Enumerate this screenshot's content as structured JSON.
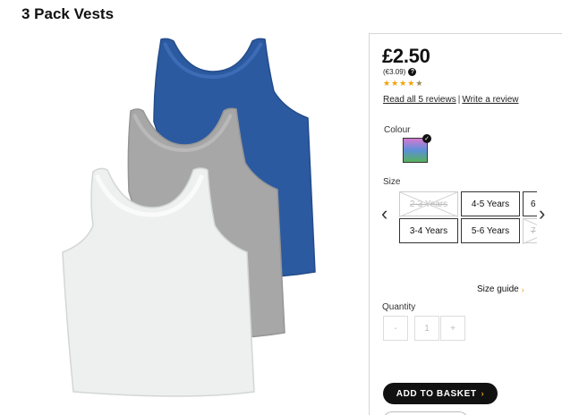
{
  "product": {
    "title": "3 Pack Vests",
    "price": "£2.50",
    "price_alt": "(€3.09)",
    "help_glyph": "?",
    "rating": 4.5,
    "stars": [
      "★",
      "★",
      "★",
      "★",
      "★"
    ],
    "read_reviews": "Read all 5 reviews",
    "separator": "|",
    "write_review": "Write a review"
  },
  "colour": {
    "label": "Colour",
    "selected_colors": [
      "#d67ad2",
      "#5b8fd8",
      "#58b25c"
    ],
    "check_glyph": "✓"
  },
  "size": {
    "label": "Size",
    "prev_icon": "‹",
    "next_icon": "›",
    "options": [
      {
        "label": "2-3 Years",
        "available": false
      },
      {
        "label": "4-5 Years",
        "available": true
      },
      {
        "label": "6",
        "available": true
      },
      {
        "label": "3-4 Years",
        "available": true
      },
      {
        "label": "5-6 Years",
        "available": true
      },
      {
        "label": "7",
        "available": false
      }
    ],
    "guide_label": "Size guide",
    "guide_arrow": "›"
  },
  "quantity": {
    "label": "Quantity",
    "minus": "-",
    "value": "1",
    "plus": "+"
  },
  "basket": {
    "label": "ADD TO BASKET",
    "arrow": "›"
  },
  "image_colors": {
    "blue": "#2c5aa0",
    "grey": "#a5a5a5",
    "white": "#eef0f0"
  }
}
